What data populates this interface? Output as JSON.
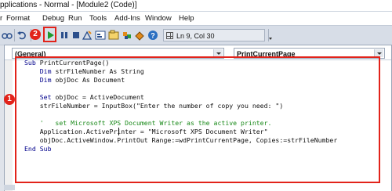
{
  "window": {
    "title": "pplications - Normal - [Module2 (Code)]"
  },
  "menu": {
    "items": [
      "r",
      "Format",
      "Debug",
      "Run",
      "Tools",
      "Add-Ins",
      "Window",
      "Help"
    ]
  },
  "toolbar": {
    "position_readout": "Ln 9, Col 30",
    "badges": {
      "run": "2"
    }
  },
  "code_window": {
    "object_combo": "(General)",
    "procedure_combo": "PrintCurrentPage",
    "badges": {
      "code": "1"
    },
    "lines": [
      {
        "keyword": "Sub ",
        "text": "PrintCurrentPage()"
      },
      {
        "keyword": "    Dim ",
        "text": "strFileNumber As String"
      },
      {
        "keyword": "    Dim ",
        "text": "objDoc As Document"
      },
      {
        "keyword": "",
        "text": ""
      },
      {
        "keyword": "    Set ",
        "text": "objDoc = ActiveDocument"
      },
      {
        "keyword": "",
        "text": "    strFileNumber = InputBox(\"Enter the number of copy you need: \")"
      },
      {
        "keyword": "",
        "text": ""
      },
      {
        "comment": "    '   set Microsoft XPS Document Writer as the active printer."
      },
      {
        "keyword": "",
        "text": "    Application.ActivePrinter = \"Microsoft XPS Document Writer\""
      },
      {
        "keyword": "",
        "text": "    objDoc.ActiveWindow.PrintOut Range:=wdPrintCurrentPage, Copies:=strFileNumber"
      },
      {
        "keyword": "End Sub",
        "text": ""
      }
    ]
  }
}
